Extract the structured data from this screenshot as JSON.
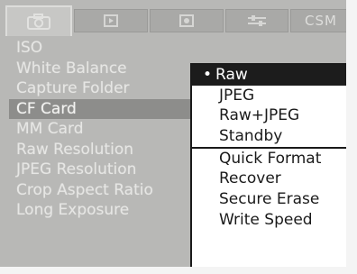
{
  "tabs": [
    {
      "label": "",
      "icon": "camera-icon",
      "active": true
    },
    {
      "label": "",
      "icon": "play-icon",
      "active": false
    },
    {
      "label": "",
      "icon": "display-icon",
      "active": false
    },
    {
      "label": "",
      "icon": "settings-sliders-icon",
      "active": false
    },
    {
      "label": "CSM",
      "icon": "",
      "active": false
    }
  ],
  "menu": {
    "items": [
      {
        "label": "ISO"
      },
      {
        "label": "White Balance"
      },
      {
        "label": "Capture Folder"
      },
      {
        "label": "CF Card",
        "selected": true
      },
      {
        "label": "MM Card"
      },
      {
        "label": "Raw Resolution"
      },
      {
        "label": "JPEG Resolution"
      },
      {
        "label": "Crop Aspect Ratio"
      },
      {
        "label": "Long Exposure"
      }
    ]
  },
  "popup": {
    "mode_options": [
      {
        "label": "Raw",
        "bullet": "•",
        "highlighted": true
      },
      {
        "label": "JPEG"
      },
      {
        "label": "Raw+JPEG"
      },
      {
        "label": "Standby"
      }
    ],
    "actions": [
      {
        "label": "Quick Format"
      },
      {
        "label": "Recover"
      },
      {
        "label": "Secure Erase"
      },
      {
        "label": "Write Speed"
      }
    ]
  },
  "colors": {
    "screen_bg": "#b8b8b6",
    "popup_bg": "#ffffff",
    "popup_highlight": "#1c1c1c",
    "menu_selected_bg": "#8d8d8b"
  }
}
